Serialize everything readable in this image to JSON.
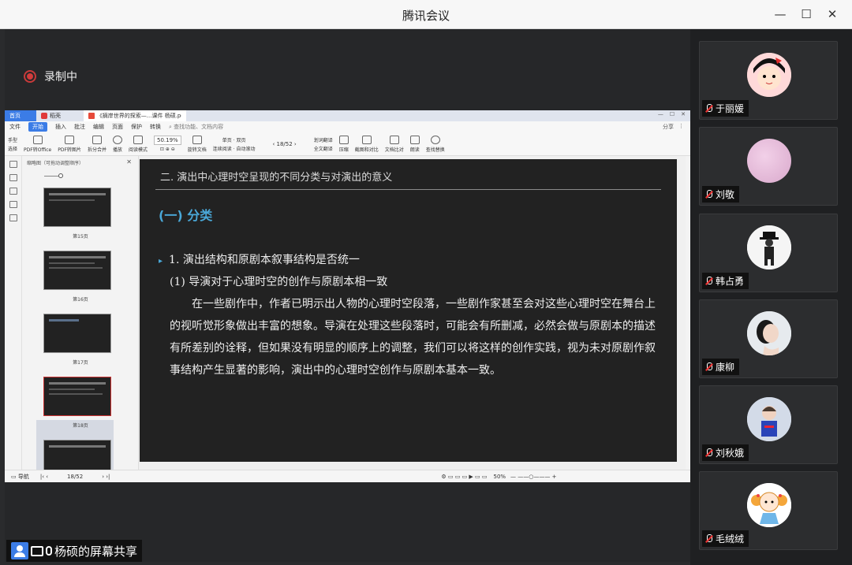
{
  "window": {
    "title": "腾讯会议",
    "min_icon": "—",
    "max_icon": "☐",
    "close_icon": "✕"
  },
  "recording": {
    "label": "录制中"
  },
  "wps": {
    "tabs": {
      "home": "首页",
      "logo": "稻壳",
      "doc": "《摘岸世界的探索—...课件 杨硕.pdf"
    },
    "menu": [
      "文件",
      "开始",
      "插入",
      "批注",
      "编辑",
      "页面",
      "保护",
      "转换"
    ],
    "search": "查找功能、文档内容",
    "share": "分享",
    "ribbon": {
      "hand": "手型",
      "select": "选择",
      "pdf2office": "PDF转Office",
      "pdf2img": "PDF转图片",
      "merge": "拆分合并",
      "play": "播放",
      "read": "阅读模式",
      "zoom": "50.19%",
      "rotate": "旋转文档",
      "single": "单页",
      "double": "双页",
      "continuous": "连续阅读",
      "autoscroll": "自动滚动",
      "page": "18/52",
      "translate": "划词翻译",
      "fulltranslate": "全文翻译",
      "compress": "压缩",
      "screenshot": "截图和对比",
      "compare": "文档比对",
      "read_aloud": "朗读",
      "find": "查找替换"
    },
    "thumbs": {
      "header": "缩略图（可拖动调整顺序）",
      "labels": [
        "第15页",
        "第16页",
        "第17页",
        "第18页"
      ]
    },
    "status": {
      "nav": "导航",
      "page": "18/52",
      "zoom": "50%"
    }
  },
  "slide": {
    "heading": "二. 演出中心理时空呈现的不同分类与对演出的意义",
    "subheading": "(一) 分类",
    "point1": "1. 演出结构和原剧本叙事结构是否统一",
    "point1a": "(1) 导演对于心理时空的创作与原剧本相一致",
    "body": "在一些剧作中，作者已明示出人物的心理时空段落，一些剧作家甚至会对这些心理时空在舞台上的视听觉形象做出丰富的想象。导演在处理这些段落时，可能会有所删减，必然会做与原剧本的描述有所差别的诠释，但如果没有明显的顺序上的调整，我们可以将这样的创作实践，视为未对原剧作叙事结构产生显著的影响，演出中的心理时空创作与原剧本基本一致。"
  },
  "participants": [
    {
      "name": "于丽媛"
    },
    {
      "name": "刘敬"
    },
    {
      "name": "韩占勇"
    },
    {
      "name": "康柳"
    },
    {
      "name": "刘秋娥"
    },
    {
      "name": "毛绒绒"
    }
  ],
  "share": {
    "label": "杨硕的屏幕共享"
  }
}
